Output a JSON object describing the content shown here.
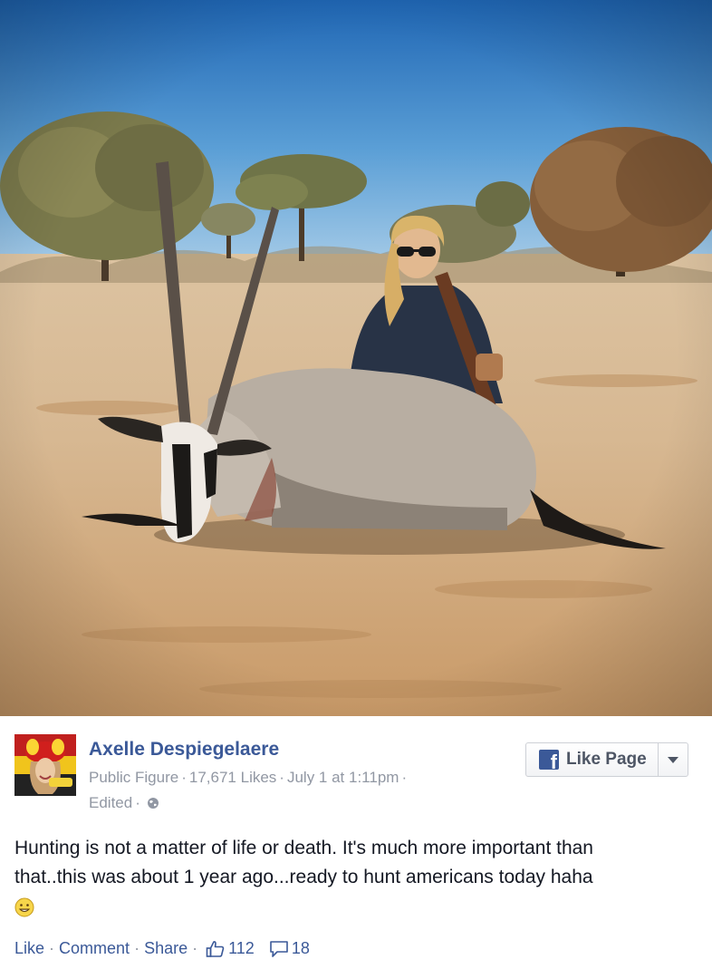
{
  "post": {
    "page_name": "Axelle Despiegelaere",
    "category": "Public Figure",
    "likes": "17,671 Likes",
    "date": "July 1 at 1:11pm",
    "edited": "Edited",
    "text_line1": "Hunting is not a matter of life or death. It's much more important than",
    "text_line2": "that..this was about 1 year ago...ready to hunt americans today haha",
    "emoji_icon": "grinning-emoji-icon"
  },
  "like_page_button": {
    "label": "Like Page",
    "icon": "facebook-icon"
  },
  "actions": {
    "like": "Like",
    "comment": "Comment",
    "share": "Share",
    "like_count": "112",
    "comment_count": "18"
  },
  "colors": {
    "link_blue": "#3b5998",
    "meta_gray": "#9197a3",
    "text": "#141823"
  }
}
